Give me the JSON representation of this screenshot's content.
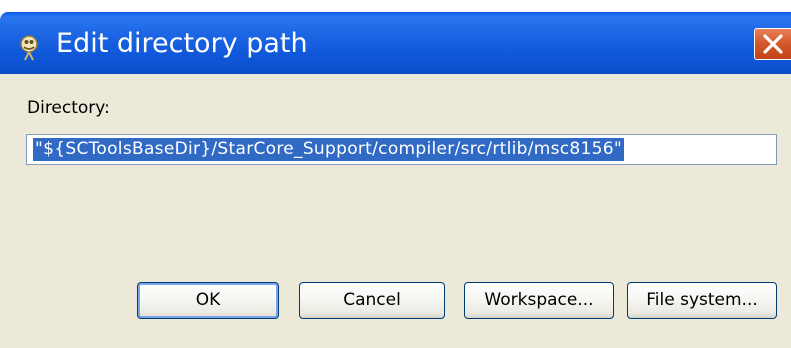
{
  "dialog": {
    "title": "Edit directory path",
    "title_icon": "eclipse-dialog-icon",
    "close_icon": "close-icon"
  },
  "form": {
    "directory_label": "Directory:",
    "directory_value": "\"${SCToolsBaseDir}/StarCore_Support/compiler/src/rtlib/msc8156\""
  },
  "buttons": {
    "ok": "OK",
    "cancel": "Cancel",
    "workspace": "Workspace...",
    "file_system": "File system..."
  },
  "colors": {
    "titlebar": "#0a5be8",
    "close_button": "#d65a2e",
    "dialog_face": "#ece9d8",
    "selection": "#316ac5"
  }
}
